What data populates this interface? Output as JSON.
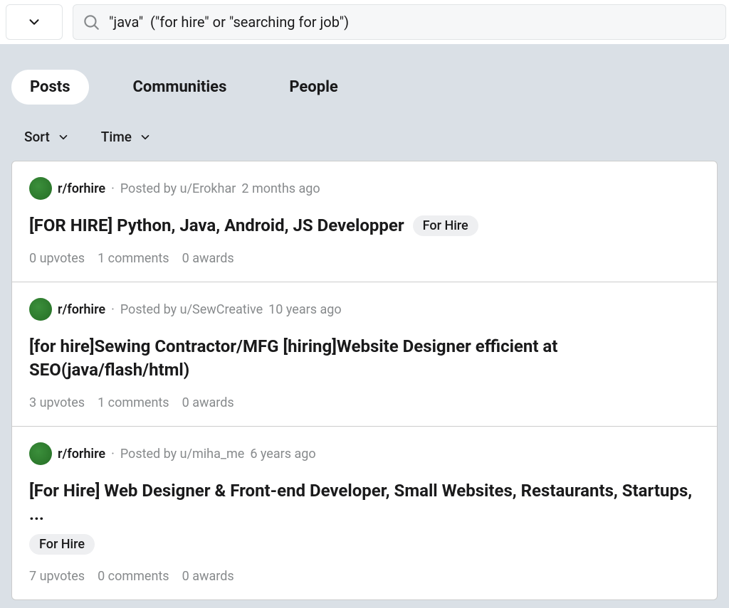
{
  "search": {
    "value": "\"java\"  (\"for hire\" or \"searching for job\")"
  },
  "tabs": {
    "posts": "Posts",
    "communities": "Communities",
    "people": "People"
  },
  "filters": {
    "sort": "Sort",
    "time": "Time"
  },
  "posts": [
    {
      "subreddit": "r/forhire",
      "postedBy": "Posted by u/Erokhar",
      "time": "2 months ago",
      "title": "[FOR HIRE] Python, Java, Android, JS Developper",
      "tag": "For Hire",
      "upvotes": "0 upvotes",
      "comments": "1 comments",
      "awards": "0 awards"
    },
    {
      "subreddit": "r/forhire",
      "postedBy": "Posted by u/SewCreative",
      "time": "10 years ago",
      "title": "[for hire]Sewing Contractor/MFG [hiring]Website Designer efficient at SEO(java/flash/html)",
      "tag": "",
      "upvotes": "3 upvotes",
      "comments": "1 comments",
      "awards": "0 awards"
    },
    {
      "subreddit": "r/forhire",
      "postedBy": "Posted by u/miha_me",
      "time": "6 years ago",
      "title": "[For Hire] Web Designer & Front-end Developer, Small Websites, Restaurants, Startups, ...",
      "tag": "For Hire",
      "upvotes": "7 upvotes",
      "comments": "0 comments",
      "awards": "0 awards"
    }
  ]
}
